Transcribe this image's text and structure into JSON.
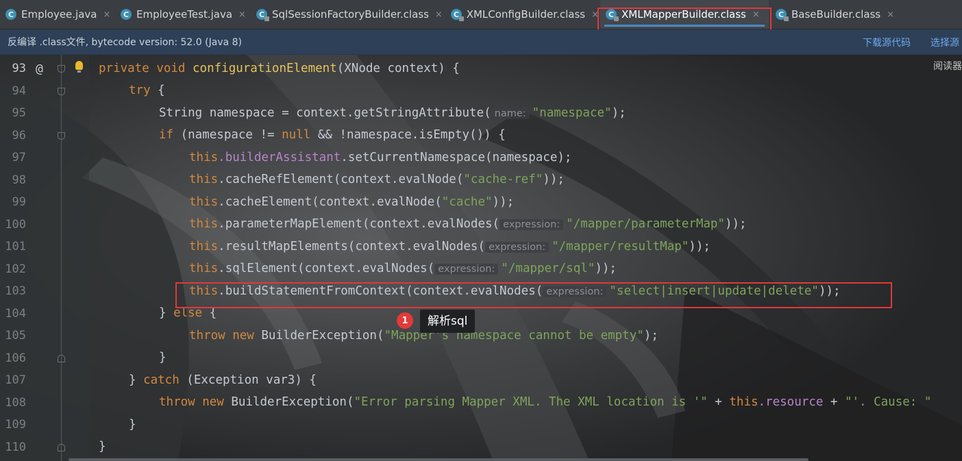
{
  "tabs": [
    {
      "label": "Employee.java",
      "icon": "class-icon"
    },
    {
      "label": "EmployeeTest.java",
      "icon": "class-icon"
    },
    {
      "label": "SqlSessionFactoryBuilder.class",
      "icon": "compiled-class-icon"
    },
    {
      "label": "XMLConfigBuilder.class",
      "icon": "compiled-class-icon"
    },
    {
      "label": "XMLMapperBuilder.class",
      "icon": "compiled-class-icon",
      "active": true
    },
    {
      "label": "BaseBuilder.class",
      "icon": "compiled-class-icon"
    }
  ],
  "close_glyph": "×",
  "infobar": {
    "message": "反编译 .class文件, bytecode version: 52.0 (Java 8)",
    "download_source": "下载源代码",
    "choose_source": "选择源"
  },
  "reader_mode": "阅读器",
  "gutter": {
    "line_numbers": [
      "93",
      "94",
      "95",
      "96",
      "97",
      "98",
      "99",
      "100",
      "101",
      "102",
      "103",
      "104",
      "105",
      "106",
      "107",
      "108",
      "109",
      "110"
    ],
    "override_mark": "@"
  },
  "code": {
    "l93": {
      "k1": "private",
      "k2": "void",
      "fn": "configurationElement",
      "rest": "(XNode context) {"
    },
    "l94": {
      "k": "try",
      "rest": " {"
    },
    "l95": {
      "a": "String namespace = context.getStringAttribute(",
      "hint": "name:",
      "s": "\"namespace\"",
      "b": ");"
    },
    "l96": {
      "k": "if",
      "a": " (namespace != ",
      "k2": "null",
      "b": " && !namespace.isEmpty()) {"
    },
    "l97": {
      "t": "this",
      "f": ".builderAssistant",
      "b": ".setCurrentNamespace(namespace);"
    },
    "l98": {
      "t": "this",
      "a": ".cacheRefElement(context.evalNode(",
      "s": "\"cache-ref\"",
      "b": "));"
    },
    "l99": {
      "t": "this",
      "a": ".cacheElement(context.evalNode(",
      "s": "\"cache\"",
      "b": "));"
    },
    "l100": {
      "t": "this",
      "a": ".parameterMapElement(context.evalNodes(",
      "hint": "expression:",
      "s": "\"/mapper/parameterMap\"",
      "b": "));"
    },
    "l101": {
      "t": "this",
      "a": ".resultMapElements(context.evalNodes(",
      "hint": "expression:",
      "s": "\"/mapper/resultMap\"",
      "b": "));"
    },
    "l102": {
      "t": "this",
      "a": ".sqlElement(context.evalNodes(",
      "hint": "expression:",
      "s": "\"/mapper/sql\"",
      "b": "));"
    },
    "l103": {
      "t": "this",
      "a": ".buildStatementFromContext(context.evalNodes(",
      "hint": "expression:",
      "s": "\"select|insert|update|delete\"",
      "b": "));"
    },
    "l104": {
      "a": "} ",
      "k": "else",
      "b": " {"
    },
    "l105": {
      "k1": "throw",
      "k2": "new",
      "a": " BuilderException(",
      "s": "\"Mapper's namespace cannot be empty\"",
      "b": ");"
    },
    "l106": {
      "a": "}"
    },
    "l107": {
      "a": "} ",
      "k": "catch",
      "b": " (Exception var3) {"
    },
    "l108": {
      "k1": "throw",
      "k2": "new",
      "a": " BuilderException(",
      "s": "\"Error parsing Mapper XML. The XML location is '\"",
      "b": " + ",
      "t": "this",
      "f": ".resource",
      "c": " + ",
      "s2": "\"'. Cause: \""
    },
    "l109": {
      "a": "}"
    },
    "l110": {
      "a": "}"
    }
  },
  "annotation": {
    "badge": "1",
    "text": "解析sql"
  },
  "colors": {
    "highlight_box": "#e0393a",
    "keyword": "#d2883f",
    "string": "#7ea55a",
    "method_decl": "#e6c35c",
    "field": "#b785c8"
  }
}
